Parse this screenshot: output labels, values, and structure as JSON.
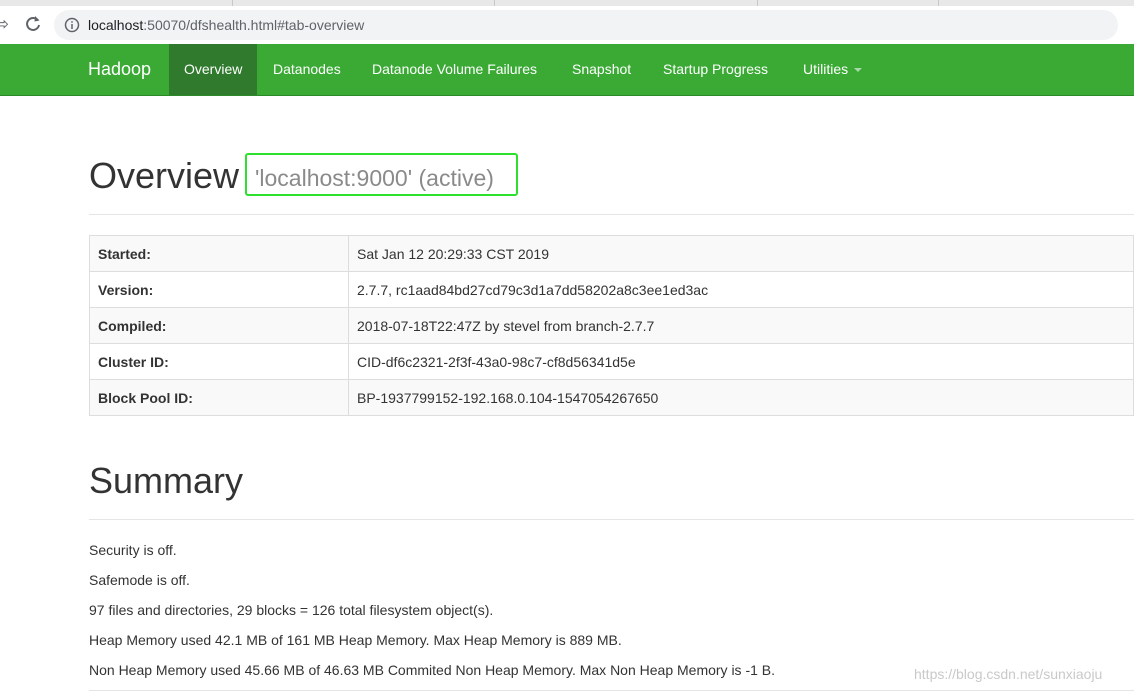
{
  "browser": {
    "back_glyph": "⇨",
    "url_host": "localhost",
    "url_rest": ":50070/dfshealth.html#tab-overview"
  },
  "navbar": {
    "brand": "Hadoop",
    "items": [
      {
        "label": "Overview",
        "active": true
      },
      {
        "label": "Datanodes"
      },
      {
        "label": "Datanode Volume Failures"
      },
      {
        "label": "Snapshot"
      },
      {
        "label": "Startup Progress"
      },
      {
        "label": "Utilities",
        "dropdown": true
      }
    ],
    "color": "#3aaa35",
    "active_color": "#2f7a2c"
  },
  "overview": {
    "title": "Overview",
    "subtitle": "'localhost:9000' (active)",
    "rows": [
      {
        "key": "Started:",
        "value": "Sat Jan 12 20:29:33 CST 2019"
      },
      {
        "key": "Version:",
        "value": "2.7.7, rc1aad84bd27cd79c3d1a7dd58202a8c3ee1ed3ac"
      },
      {
        "key": "Compiled:",
        "value": "2018-07-18T22:47Z by stevel from branch-2.7.7"
      },
      {
        "key": "Cluster ID:",
        "value": "CID-df6c2321-2f3f-43a0-98c7-cf8d56341d5e"
      },
      {
        "key": "Block Pool ID:",
        "value": "BP-1937799152-192.168.0.104-1547054267650"
      }
    ]
  },
  "summary": {
    "title": "Summary",
    "lines": [
      "Security is off.",
      "Safemode is off.",
      "97 files and directories, 29 blocks = 126 total filesystem object(s).",
      "Heap Memory used 42.1 MB of 161 MB Heap Memory. Max Heap Memory is 889 MB.",
      "Non Heap Memory used 45.66 MB of 46.63 MB Commited Non Heap Memory. Max Non Heap Memory is -1 B."
    ]
  },
  "watermark": "https://blog.csdn.net/sunxiaoju"
}
